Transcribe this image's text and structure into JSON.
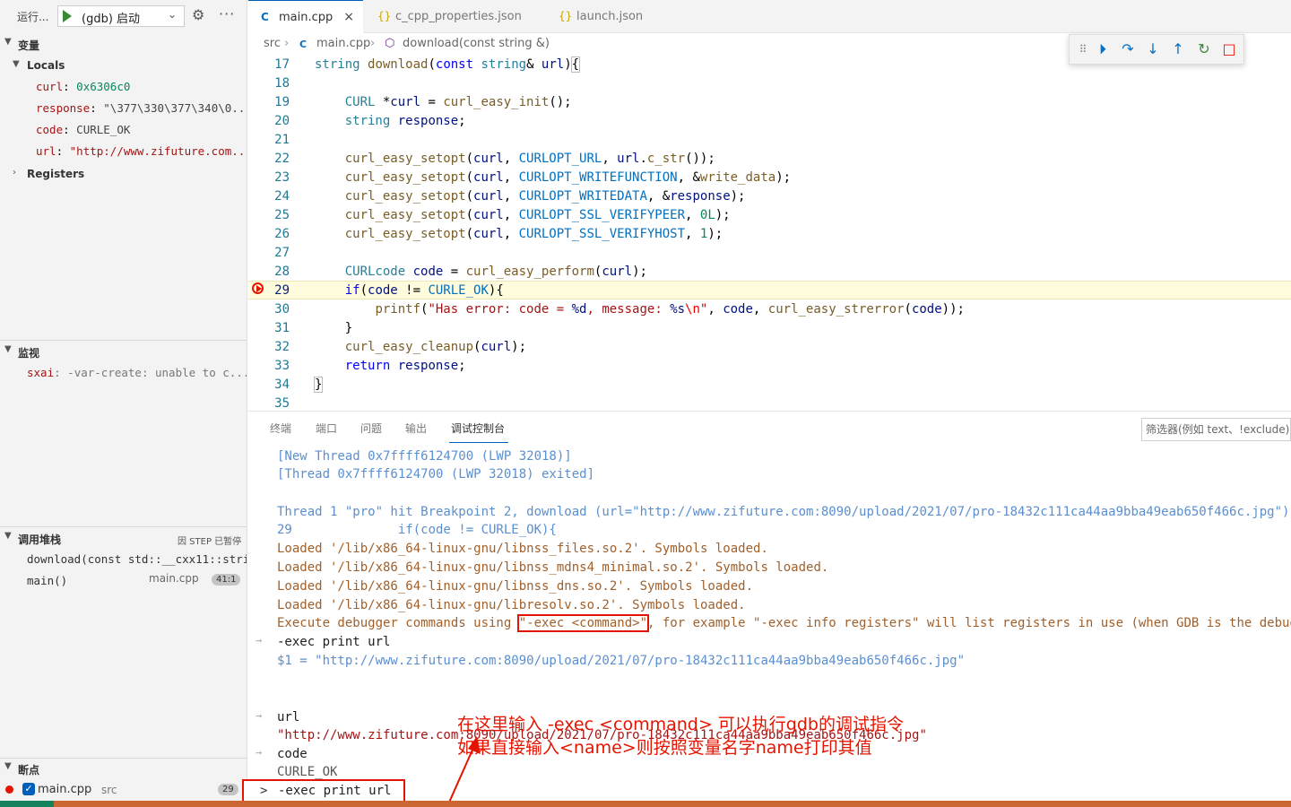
{
  "sidebar": {
    "run_label": "运行...",
    "config_label": "(gdb) 启动",
    "variables_title": "变量",
    "locals_label": "Locals",
    "locals": [
      {
        "name": "curl",
        "value": "0x6306c0"
      },
      {
        "name": "response",
        "value": "\"\\377\\330\\377\\340\\0..."
      },
      {
        "name": "code",
        "value": "CURLE_OK"
      },
      {
        "name": "url",
        "value": "\"http://www.zifuture.com..."
      }
    ],
    "registers_label": "Registers",
    "watch_title": "监视",
    "watch_item": {
      "name": "sxai",
      "value": "-var-create: unable to c..."
    },
    "callstack_title": "调用堆栈",
    "callstack_paused": "因 STEP 已暂停",
    "callstack": [
      {
        "name": "download(const std::__cxx11::stri..."
      },
      {
        "name": "main()",
        "file": "main.cpp",
        "pos": "41:1"
      }
    ],
    "breakpoints_title": "断点",
    "breakpoint": {
      "file": "main.cpp",
      "dir": "src",
      "line": "29"
    }
  },
  "tabs": [
    {
      "label": "main.cpp",
      "icon": "C",
      "close": "×"
    },
    {
      "label": "c_cpp_properties.json",
      "icon": "{}"
    },
    {
      "label": "launch.json",
      "icon": "{}"
    }
  ],
  "breadcrumb": {
    "folder": "src",
    "file": "main.cpp",
    "symbol": "download(const string &)"
  },
  "debug_toolbar": [
    "drag-handle",
    "continue",
    "step-over",
    "step-into",
    "step-out",
    "restart",
    "stop"
  ],
  "code": {
    "lines": [
      {
        "n": "17"
      },
      {
        "n": "18"
      },
      {
        "n": "19"
      },
      {
        "n": "20"
      },
      {
        "n": "21"
      },
      {
        "n": "22"
      },
      {
        "n": "23"
      },
      {
        "n": "24"
      },
      {
        "n": "25"
      },
      {
        "n": "26"
      },
      {
        "n": "27"
      },
      {
        "n": "28"
      },
      {
        "n": "29"
      },
      {
        "n": "30"
      },
      {
        "n": "31"
      },
      {
        "n": "32"
      },
      {
        "n": "33"
      },
      {
        "n": "34"
      },
      {
        "n": "35"
      }
    ],
    "current_line": "29"
  },
  "panel": {
    "tabs": [
      "终端",
      "端口",
      "问题",
      "输出",
      "调试控制台"
    ],
    "active_tab": "调试控制台",
    "filter_placeholder": "筛选器(例如 text、!exclude)",
    "console": {
      "l1": "[New Thread 0x7ffff6124700 (LWP 32018)]",
      "l2": "[Thread 0x7ffff6124700 (LWP 32018) exited]",
      "l3": "Thread 1 \"pro\" hit Breakpoint 2, download (url=\"http://www.zifuture.com:8090/upload/2021/07/pro-18432c111ca44aa9bba49eab650f466c.jpg\")",
      "l4": "29              if(code != CURLE_OK){",
      "l5": "Loaded '/lib/x86_64-linux-gnu/libnss_files.so.2'. Symbols loaded.",
      "l6": "Loaded '/lib/x86_64-linux-gnu/libnss_mdns4_minimal.so.2'. Symbols loaded.",
      "l7": "Loaded '/lib/x86_64-linux-gnu/libnss_dns.so.2'. Symbols loaded.",
      "l8": "Loaded '/lib/x86_64-linux-gnu/libresolv.so.2'. Symbols loaded.",
      "l9a": "Execute debugger commands using ",
      "l9b": "\"-exec <command>\"",
      "l9c": ", for example \"-exec info registers\" will list registers in use (when GDB is the debugger)",
      "l10": "-exec print url",
      "l11": "$1 = \"http://www.zifuture.com:8090/upload/2021/07/pro-18432c111ca44aa9bba49eab650f466c.jpg\"",
      "l12": "url",
      "l13": "\"http://www.zifuture.com:8090/upload/2021/07/pro-18432c111ca44aa9bba49eab650f466c.jpg\"",
      "l14": "code",
      "l15": "CURLE_OK"
    },
    "annotation_line1": "在这里输入 -exec <command> 可以执行gdb的调试指令",
    "annotation_line2": "如果直接输入<name>则按照变量名字name打印其值",
    "repl_prompt": ">",
    "repl_value": "-exec print url"
  },
  "colors": {
    "breakpoint": "#e51400",
    "accent": "#005fb8",
    "status_bar": "#cc6633",
    "annotation": "#e51400"
  }
}
